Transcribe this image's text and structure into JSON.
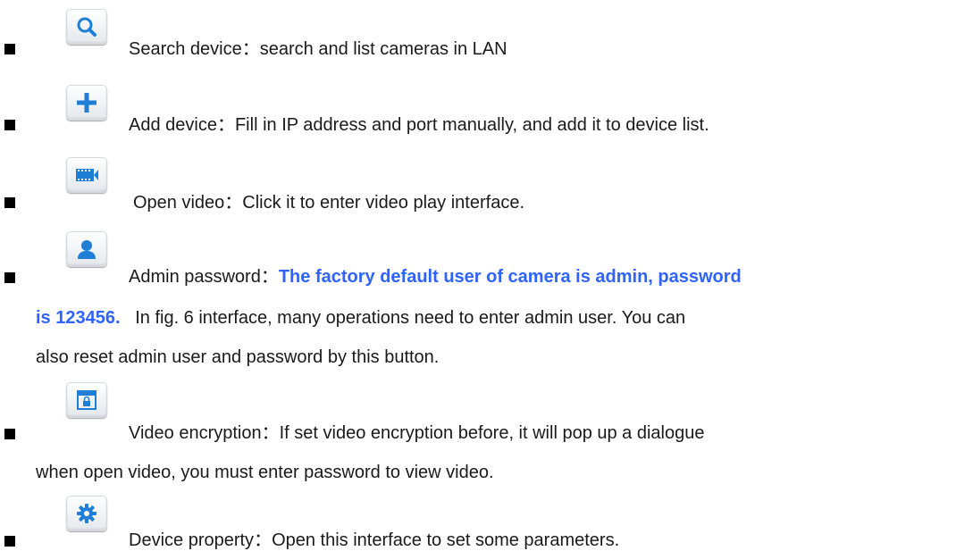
{
  "items": [
    {
      "icon": "search-icon",
      "label": "Search device",
      "sep": "：",
      "text": "search and list cameras in LAN"
    },
    {
      "icon": "plus-icon",
      "label": "Add device",
      "sep": "：",
      "text": "Fill in IP address and port manually, and add it to device list."
    },
    {
      "icon": "video-film-icon",
      "label": "Open video",
      "sep": "：",
      "text": "Click it to enter video play interface."
    },
    {
      "icon": "user-icon",
      "label": "Admin password",
      "sep": "：",
      "highlight_1": "The factory default user of camera is admin, password",
      "highlight_2": "is 123456.",
      "text_1": "In fig. 6 interface, many operations need to enter admin user. You can",
      "text_2": "also reset admin user and password by this button."
    },
    {
      "icon": "lock-window-icon",
      "label": "Video encryption",
      "sep": "：",
      "text_1": "If set video encryption before, it will pop up a dialogue",
      "text_2": "when open video, you must enter password to view video."
    },
    {
      "icon": "gear-icon",
      "label": "Device property",
      "sep": "：",
      "text": "Open this interface to set some parameters."
    }
  ],
  "colors": {
    "highlight": "#2f63ff",
    "icon_blue": "#1f7fd6",
    "text": "#1a1a1a"
  }
}
